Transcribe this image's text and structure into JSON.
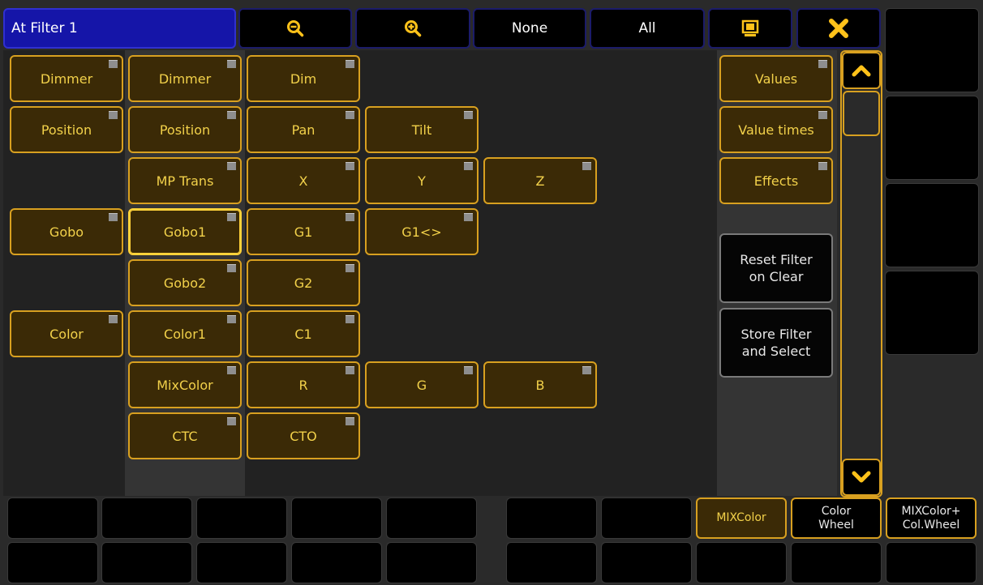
{
  "window": {
    "title": "At Filter 1"
  },
  "toolbar": {
    "zoom_out_icon": "zoom-out-icon",
    "zoom_in_icon": "zoom-in-icon",
    "none_label": "None",
    "all_label": "All",
    "screen_icon": "monitor-icon",
    "close_icon": "close-icon",
    "accent_close": "#ffc21a"
  },
  "columns": {
    "col1": [
      "Dimmer",
      "Position",
      "Gobo",
      "Color"
    ],
    "col2": [
      "Dimmer",
      "Position",
      "MP Trans",
      "Gobo1",
      "Gobo2",
      "Color1",
      "MixColor",
      "CTC"
    ],
    "col3": [
      "Dim",
      "Pan",
      "X",
      "G1",
      "G2",
      "C1",
      "R",
      "CTO"
    ],
    "col4": [
      "Tilt",
      "Y",
      "G1<>",
      "G"
    ],
    "col5": [
      "Z",
      "B"
    ]
  },
  "right_panel": {
    "values": "Values",
    "value_times": "Value times",
    "effects": "Effects",
    "reset_line1": "Reset Filter",
    "reset_line2": "on Clear",
    "store_line1": "Store Filter",
    "store_line2": "and Select"
  },
  "scrollbar": {
    "up_icon": "chevron-up-icon",
    "down_icon": "chevron-down-icon"
  },
  "bottom": {
    "mixcolor": "MIXColor",
    "colorwheel_line1": "Color",
    "colorwheel_line2": "Wheel",
    "mixwheel_line1": "MIXColor+",
    "mixwheel_line2": "Col.Wheel"
  },
  "colors": {
    "title_bg": "#1515a8",
    "button_fill": "#3b2a06",
    "button_border": "#d8a020",
    "button_text": "#f2d14a"
  }
}
